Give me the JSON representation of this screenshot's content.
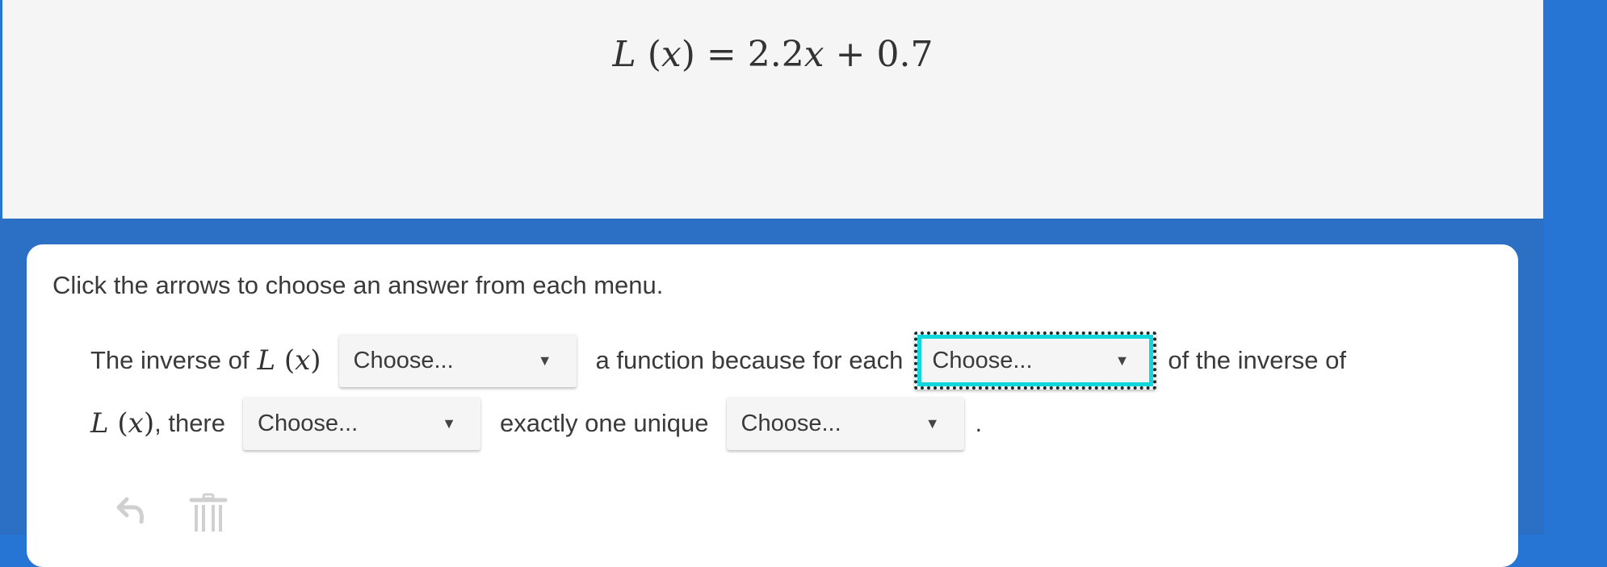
{
  "equation": {
    "lhs_func": "L",
    "lhs_var": "x",
    "equals": "=",
    "coefficient": "2.2",
    "rhs_var": "x",
    "plus": "+",
    "constant": "0.7"
  },
  "instruction": "Click the arrows to choose an answer from each menu.",
  "sentence": {
    "part1": "The inverse of",
    "part2": "a function because for each",
    "part3": "of the inverse of",
    "part4": ", there",
    "part5": "exactly one unique",
    "part6": "."
  },
  "math_token": {
    "func": "L",
    "var": "x"
  },
  "dropdowns": [
    {
      "value": "Choose..."
    },
    {
      "value": "Choose..."
    },
    {
      "value": "Choose..."
    },
    {
      "value": "Choose..."
    }
  ],
  "icons": {
    "undo": "undo-arrow-icon",
    "delete": "trash-icon"
  },
  "colors": {
    "background_blue": "#2674d3",
    "focus_ring": "#11d6dc",
    "toolbar_icon": "#d0d0d0"
  }
}
